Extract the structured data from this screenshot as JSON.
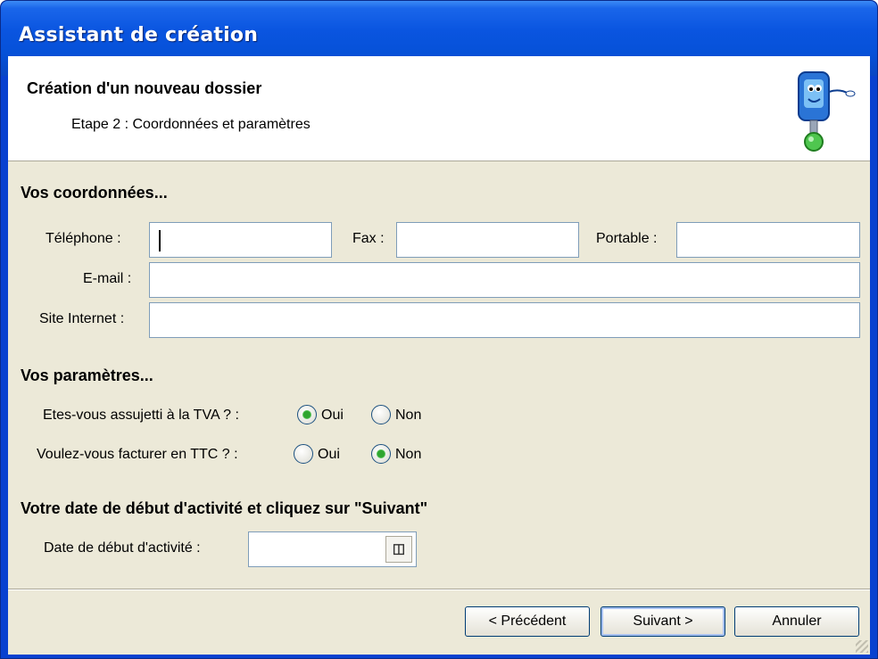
{
  "window": {
    "title": "Assistant de création"
  },
  "header": {
    "title": "Création d'un nouveau dossier",
    "subtitle": "Etape 2 : Coordonnées et paramètres",
    "icon": "computer-mascot-icon"
  },
  "contact": {
    "section_title": "Vos coordonnées...",
    "phone_label": "Téléphone :",
    "phone_value": "",
    "fax_label": "Fax :",
    "fax_value": "",
    "mobile_label": "Portable :",
    "mobile_value": "",
    "email_label": "E-mail :",
    "email_value": "",
    "website_label": "Site Internet :",
    "website_value": ""
  },
  "params": {
    "section_title": "Vos paramètres...",
    "vat_question": "Etes-vous assujetti à la TVA ? :",
    "vat_yes": "Oui",
    "vat_no": "Non",
    "vat_selected": "Oui",
    "ttc_question": "Voulez-vous facturer en TTC ? :",
    "ttc_yes": "Oui",
    "ttc_no": "Non",
    "ttc_selected": "Non"
  },
  "start": {
    "section_title": "Votre date de début d'activité et cliquez sur \"Suivant\"",
    "date_label": "Date de début d'activité :",
    "date_value": "",
    "calendar_icon": "calendar-icon"
  },
  "buttons": {
    "previous": "< Précédent",
    "next": "Suivant >",
    "cancel": "Annuler"
  },
  "colors": {
    "titlebar": "#0a55e0",
    "dialog_bg": "#ece9d8",
    "radio_check": "#2fa52f"
  }
}
